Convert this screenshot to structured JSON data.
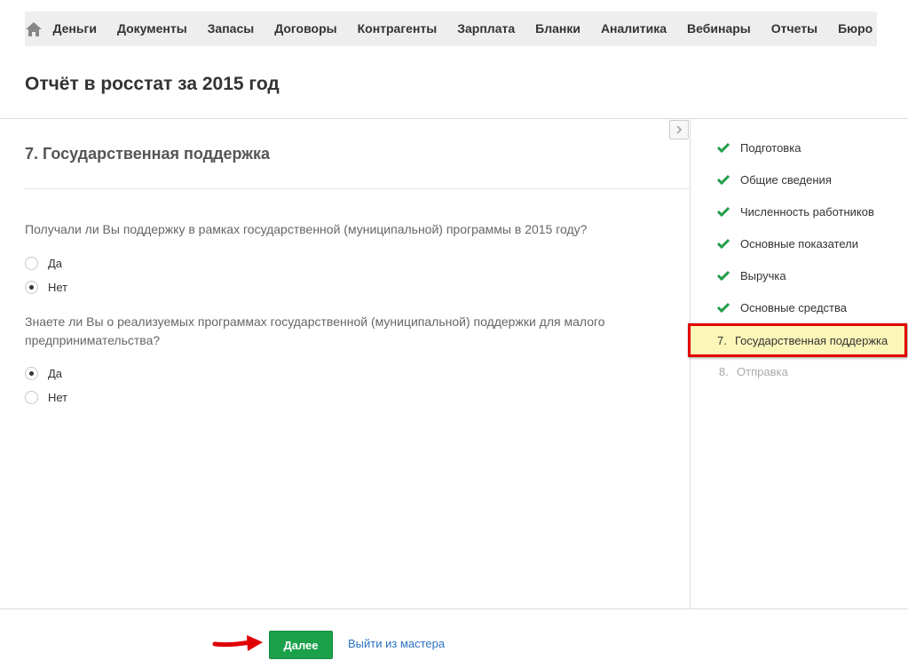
{
  "topnav": {
    "home_icon": "home-icon",
    "items": [
      "Деньги",
      "Документы",
      "Запасы",
      "Договоры",
      "Контрагенты",
      "Зарплата",
      "Бланки",
      "Аналитика",
      "Вебинары",
      "Отчеты",
      "Бюро"
    ]
  },
  "page": {
    "title": "Отчёт в росстат за 2015 год"
  },
  "section": {
    "title": "7. Государственная поддержка"
  },
  "questions": [
    {
      "text": "Получали ли Вы поддержку в рамках государственной (муниципальной) программы в 2015 году?",
      "options": [
        {
          "label": "Да",
          "selected": false
        },
        {
          "label": "Нет",
          "selected": true
        }
      ]
    },
    {
      "text": "Знаете ли Вы о реализуемых программах государственной (муниципальной) поддержки для малого предпринимательства?",
      "options": [
        {
          "label": "Да",
          "selected": true
        },
        {
          "label": "Нет",
          "selected": false
        }
      ]
    }
  ],
  "steps": [
    {
      "label": "Подготовка",
      "status": "done"
    },
    {
      "label": "Общие сведения",
      "status": "done"
    },
    {
      "label": "Численность работников",
      "status": "done"
    },
    {
      "label": "Основные показатели",
      "status": "done"
    },
    {
      "label": "Выручка",
      "status": "done"
    },
    {
      "label": "Основные средства",
      "status": "done"
    },
    {
      "number": "7.",
      "label": "Государственная поддержка",
      "status": "active"
    },
    {
      "number": "8.",
      "label": "Отправка",
      "status": "pending"
    }
  ],
  "footer": {
    "next_label": "Далее",
    "exit_label": "Выйти из мастера"
  },
  "colors": {
    "accent_green": "#1aa14a",
    "check_green": "#1f9d4a",
    "highlight_bg": "#fbf7b8",
    "highlight_border": "#e00000",
    "link_blue": "#2a72c0"
  }
}
